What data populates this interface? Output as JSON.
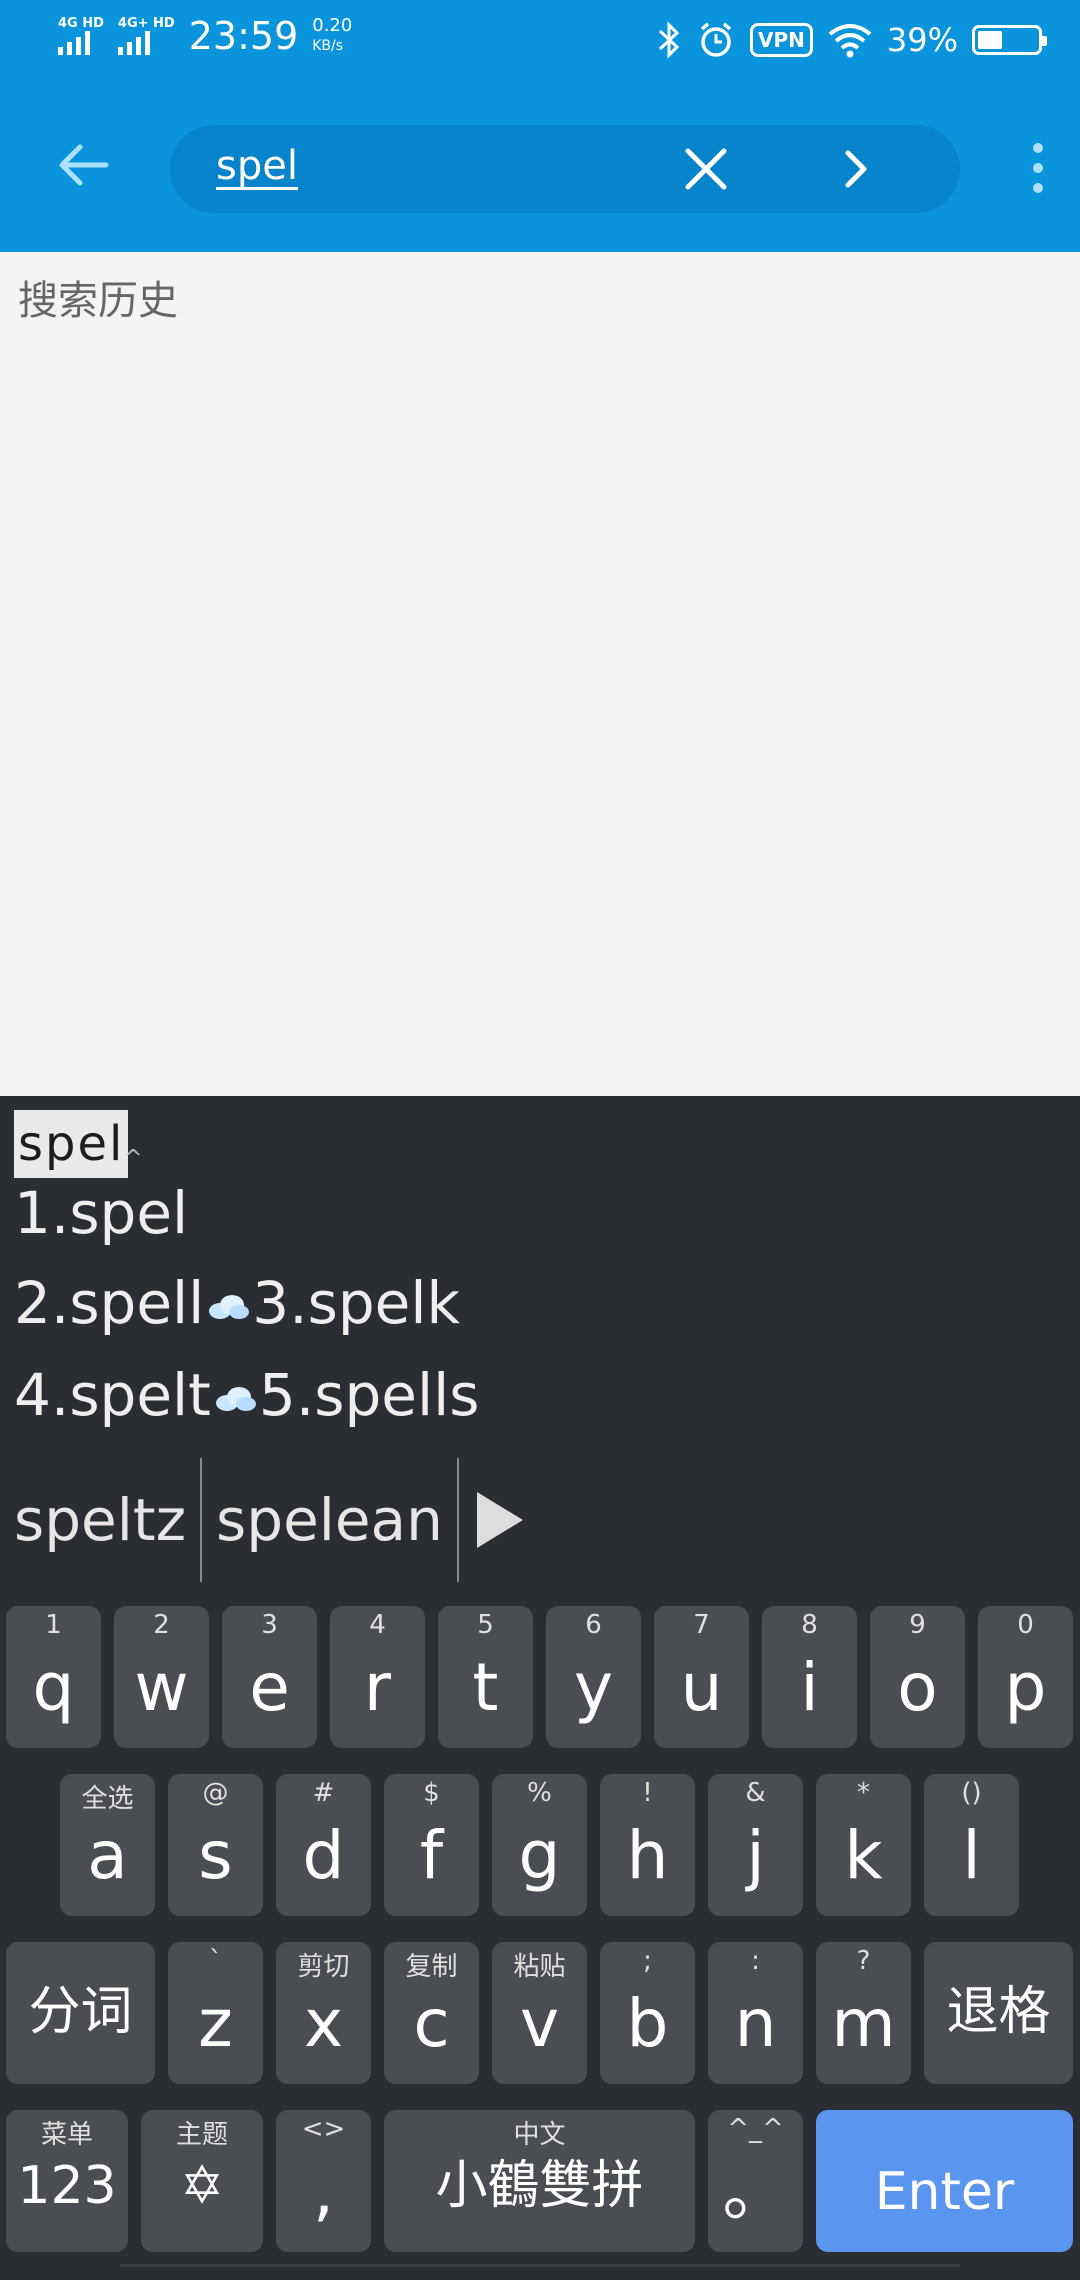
{
  "status_bar": {
    "sim1": "4G HD",
    "sim2": "4G+ HD",
    "time": "23:59",
    "net_speed": "0.20",
    "net_unit": "KB/s",
    "vpn": "VPN",
    "battery": "39%"
  },
  "search": {
    "query": "spel"
  },
  "history_title": "搜索历史",
  "ime": {
    "composition": "spel",
    "candidates_line1": "1.spel",
    "cand2": "2.spell",
    "cand3": "3.spelk",
    "cand4": "4.spelt",
    "cand5": "5.spells",
    "suggestions": [
      "speltz",
      "spelean"
    ],
    "row1": [
      {
        "sub": "1",
        "main": "q"
      },
      {
        "sub": "2",
        "main": "w"
      },
      {
        "sub": "3",
        "main": "e"
      },
      {
        "sub": "4",
        "main": "r"
      },
      {
        "sub": "5",
        "main": "t"
      },
      {
        "sub": "6",
        "main": "y"
      },
      {
        "sub": "7",
        "main": "u"
      },
      {
        "sub": "8",
        "main": "i"
      },
      {
        "sub": "9",
        "main": "o"
      },
      {
        "sub": "0",
        "main": "p"
      }
    ],
    "row2": [
      {
        "sub": "全选",
        "main": "a"
      },
      {
        "sub": "@",
        "main": "s"
      },
      {
        "sub": "#",
        "main": "d"
      },
      {
        "sub": "$",
        "main": "f"
      },
      {
        "sub": "%",
        "main": "g"
      },
      {
        "sub": "!",
        "main": "h"
      },
      {
        "sub": "&",
        "main": "j"
      },
      {
        "sub": "*",
        "main": "k"
      },
      {
        "sub": "()",
        "main": "l"
      }
    ],
    "row3": {
      "left": "分词",
      "keys": [
        {
          "sub": "`",
          "main": "z"
        },
        {
          "sub": "剪切",
          "main": "x"
        },
        {
          "sub": "复制",
          "main": "c"
        },
        {
          "sub": "粘贴",
          "main": "v"
        },
        {
          "sub": ";",
          "main": "b"
        },
        {
          "sub": ":",
          "main": "n"
        },
        {
          "sub": "?",
          "main": "m"
        }
      ],
      "right": "退格"
    },
    "row4": {
      "menu_sub": "菜单",
      "menu_main": "123",
      "theme_sub": "主题",
      "theme_main": "✡",
      "comma_sub": "<>",
      "comma_main": ",",
      "space_sub": "中文",
      "space_main": "小鶴雙拼",
      "period_sub": "^_^",
      "period_main": "。",
      "enter": "Enter"
    }
  }
}
